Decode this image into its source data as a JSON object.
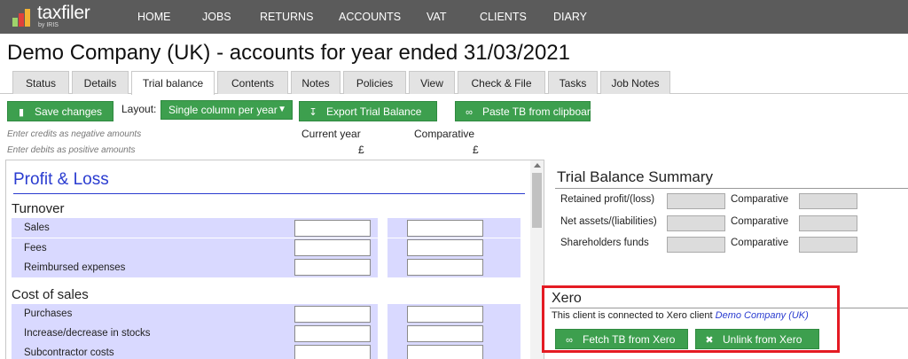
{
  "brand": {
    "name": "taxfiler",
    "sub": "by IRIS"
  },
  "nav": [
    "HOME",
    "JOBS",
    "RETURNS",
    "ACCOUNTS",
    "VAT",
    "CLIENTS",
    "DIARY"
  ],
  "title": "Demo Company (UK) - accounts for year ended 31/03/2021",
  "tabs": [
    {
      "label": "Status"
    },
    {
      "label": "Details"
    },
    {
      "label": "Trial balance",
      "active": true
    },
    {
      "label": "Contents"
    },
    {
      "label": "Notes"
    },
    {
      "label": "Policies"
    },
    {
      "label": "View"
    },
    {
      "label": "Check & File"
    },
    {
      "label": "Tasks"
    },
    {
      "label": "Job Notes"
    }
  ],
  "toolbar": {
    "save": "Save changes",
    "layout_label": "Layout:",
    "layout_value": "Single column per year",
    "export": "Export Trial Balance",
    "paste": "Paste TB from clipboard"
  },
  "hints": {
    "credits": "Enter credits as negative amounts",
    "debits": "Enter debits as positive amounts"
  },
  "columns": {
    "current": "Current year",
    "comparative": "Comparative",
    "currency": "£"
  },
  "pl": {
    "title": "Profit & Loss",
    "turnover": {
      "heading": "Turnover",
      "rows": [
        "Sales",
        "Fees",
        "Reimbursed expenses"
      ]
    },
    "cost_of_sales": {
      "heading": "Cost of sales",
      "rows": [
        "Purchases",
        "Increase/decrease in stocks",
        "Subcontractor costs"
      ]
    }
  },
  "summary": {
    "title": "Trial Balance Summary",
    "rows": [
      "Retained profit/(loss)",
      "Net assets/(liabilities)",
      "Shareholders funds"
    ],
    "comparative": "Comparative"
  },
  "xero": {
    "title": "Xero",
    "text": "This client is connected to Xero client",
    "client": "Demo Company (UK)",
    "fetch": "Fetch TB from Xero",
    "unlink": "Unlink from Xero"
  },
  "colors": {
    "green": "#3d9f4e",
    "band": "#d9d9ff",
    "link": "#2a3cd0",
    "highlight": "#e41b23"
  }
}
